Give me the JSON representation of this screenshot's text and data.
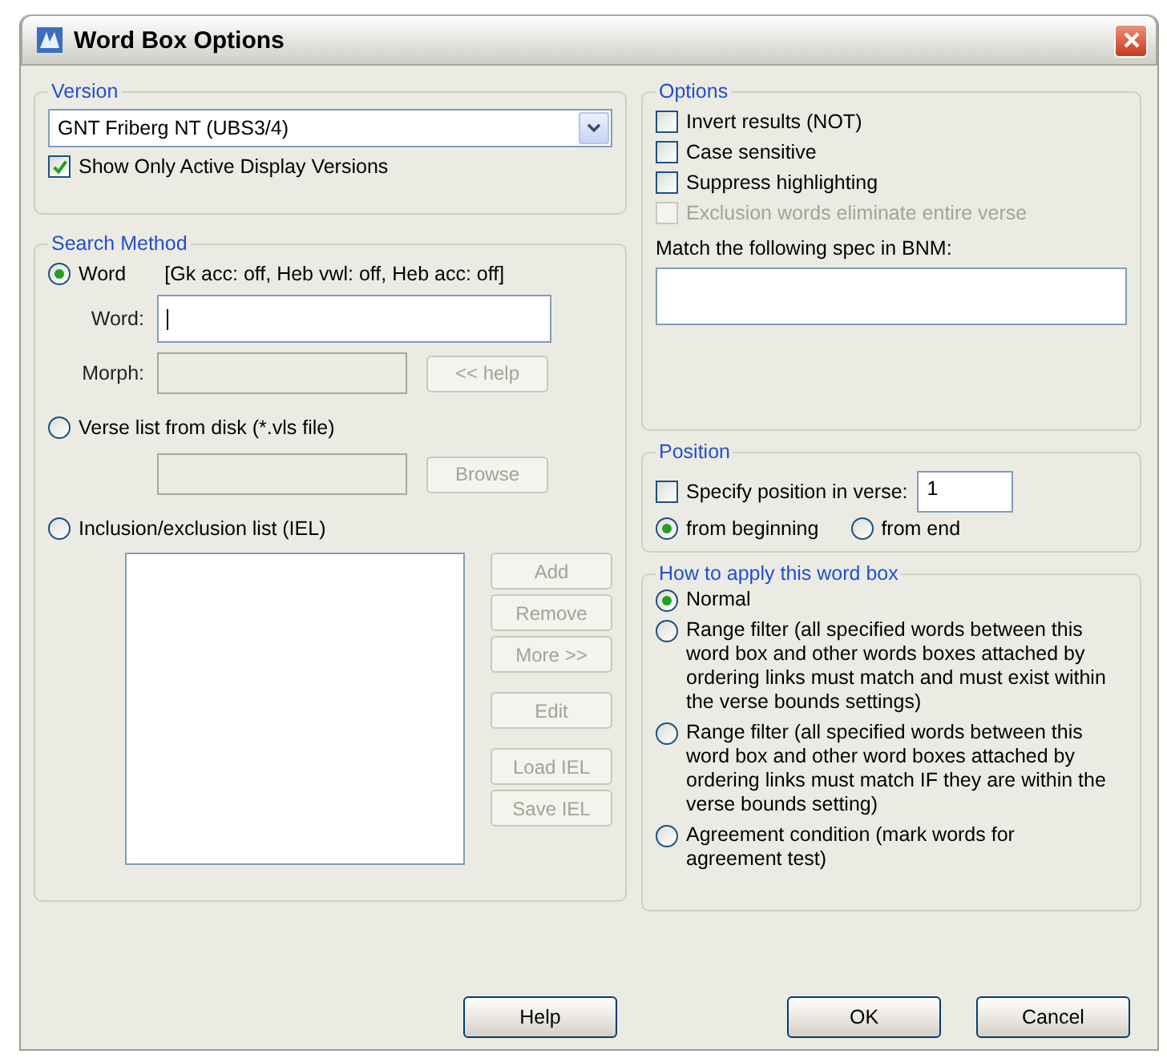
{
  "window": {
    "title": "Word Box Options"
  },
  "version": {
    "label": "Version",
    "value": "GNT Friberg NT (UBS3/4)",
    "show_only_active": {
      "label": "Show Only Active Display Versions",
      "checked": true
    }
  },
  "search_method": {
    "label": "Search Method",
    "methods": [
      {
        "kind": "word",
        "label": "Word",
        "selected": true,
        "info": "[Gk acc: off, Heb vwl: off, Heb acc: off]",
        "word_label": "Word:",
        "morph_label": "Morph:",
        "morph_disabled": true,
        "help_button": {
          "label": "<< help",
          "disabled": true
        }
      },
      {
        "kind": "verse_list",
        "label": "Verse list from disk (*.vls file)",
        "selected": false,
        "field_disabled": true,
        "browse_button": {
          "label": "Browse",
          "disabled": true
        }
      },
      {
        "kind": "iel",
        "label": "Inclusion/exclusion list (IEL)",
        "selected": false,
        "button_groups": [
          [
            {
              "label": "Add",
              "disabled": true
            },
            {
              "label": "Remove",
              "disabled": true
            },
            {
              "label": "More >>",
              "disabled": true
            }
          ],
          [
            {
              "label": "Edit",
              "disabled": true
            }
          ],
          [
            {
              "label": "Load IEL",
              "disabled": true
            },
            {
              "label": "Save IEL",
              "disabled": true
            }
          ]
        ]
      }
    ]
  },
  "options": {
    "label": "Options",
    "checkboxes": [
      {
        "label": "Invert results (NOT)",
        "checked": false,
        "disabled": false
      },
      {
        "label": "Case sensitive",
        "checked": false,
        "disabled": false
      },
      {
        "label": "Suppress highlighting",
        "checked": false,
        "disabled": false
      },
      {
        "label": "Exclusion words eliminate entire verse",
        "checked": false,
        "disabled": true
      }
    ],
    "bnm_label": "Match the following spec in BNM:"
  },
  "position": {
    "label": "Position",
    "specify": {
      "label": "Specify position in verse:",
      "checked": false
    },
    "value": "1",
    "from": [
      {
        "label": "from beginning",
        "selected": true
      },
      {
        "label": "from end",
        "selected": false
      }
    ]
  },
  "apply": {
    "label": "How to apply this word box",
    "modes": [
      {
        "label": "Normal",
        "selected": true
      },
      {
        "label": "Range filter (all specified words between this word box and other words boxes attached by ordering links must match and must exist within the verse bounds settings)",
        "selected": false
      },
      {
        "label": "Range filter (all specified words between this word box and other word boxes attached by ordering links must match IF they are within the verse bounds setting)",
        "selected": false
      },
      {
        "label": "Agreement condition (mark words for agreement test)",
        "selected": false
      }
    ]
  },
  "buttons": [
    {
      "label": "Help",
      "kind": "help"
    },
    {
      "label": "OK",
      "kind": "ok"
    },
    {
      "label": "Cancel",
      "kind": "cancel"
    }
  ]
}
